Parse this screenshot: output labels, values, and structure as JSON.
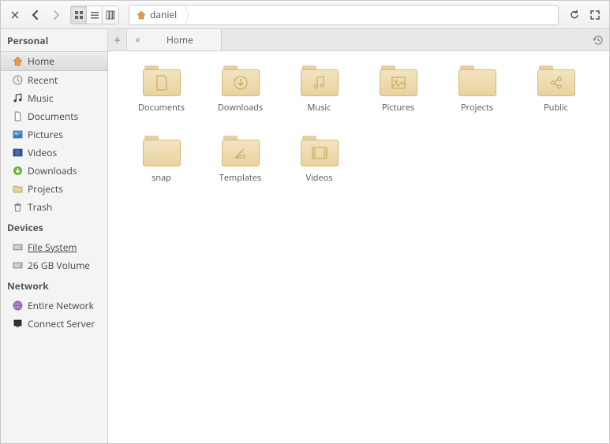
{
  "breadcrumb": {
    "label": "daniel"
  },
  "tab": {
    "label": "Home"
  },
  "sidebar": {
    "sections": [
      {
        "title": "Personal",
        "items": [
          {
            "label": "Home",
            "icon": "home"
          },
          {
            "label": "Recent",
            "icon": "recent"
          },
          {
            "label": "Music",
            "icon": "music"
          },
          {
            "label": "Documents",
            "icon": "doc"
          },
          {
            "label": "Pictures",
            "icon": "pic"
          },
          {
            "label": "Videos",
            "icon": "video"
          },
          {
            "label": "Downloads",
            "icon": "download"
          },
          {
            "label": "Projects",
            "icon": "folder"
          },
          {
            "label": "Trash",
            "icon": "trash"
          }
        ]
      },
      {
        "title": "Devices",
        "items": [
          {
            "label": "File System",
            "icon": "disk"
          },
          {
            "label": "26 GB Volume",
            "icon": "disk"
          }
        ]
      },
      {
        "title": "Network",
        "items": [
          {
            "label": "Entire Network",
            "icon": "network"
          },
          {
            "label": "Connect Server",
            "icon": "server"
          }
        ]
      }
    ]
  },
  "folders": [
    {
      "name": "Documents",
      "glyph": "doc"
    },
    {
      "name": "Downloads",
      "glyph": "download"
    },
    {
      "name": "Music",
      "glyph": "music"
    },
    {
      "name": "Pictures",
      "glyph": "pic"
    },
    {
      "name": "Projects",
      "glyph": "plain"
    },
    {
      "name": "Public",
      "glyph": "share"
    },
    {
      "name": "snap",
      "glyph": "plain"
    },
    {
      "name": "Templates",
      "glyph": "template"
    },
    {
      "name": "Videos",
      "glyph": "video"
    }
  ]
}
